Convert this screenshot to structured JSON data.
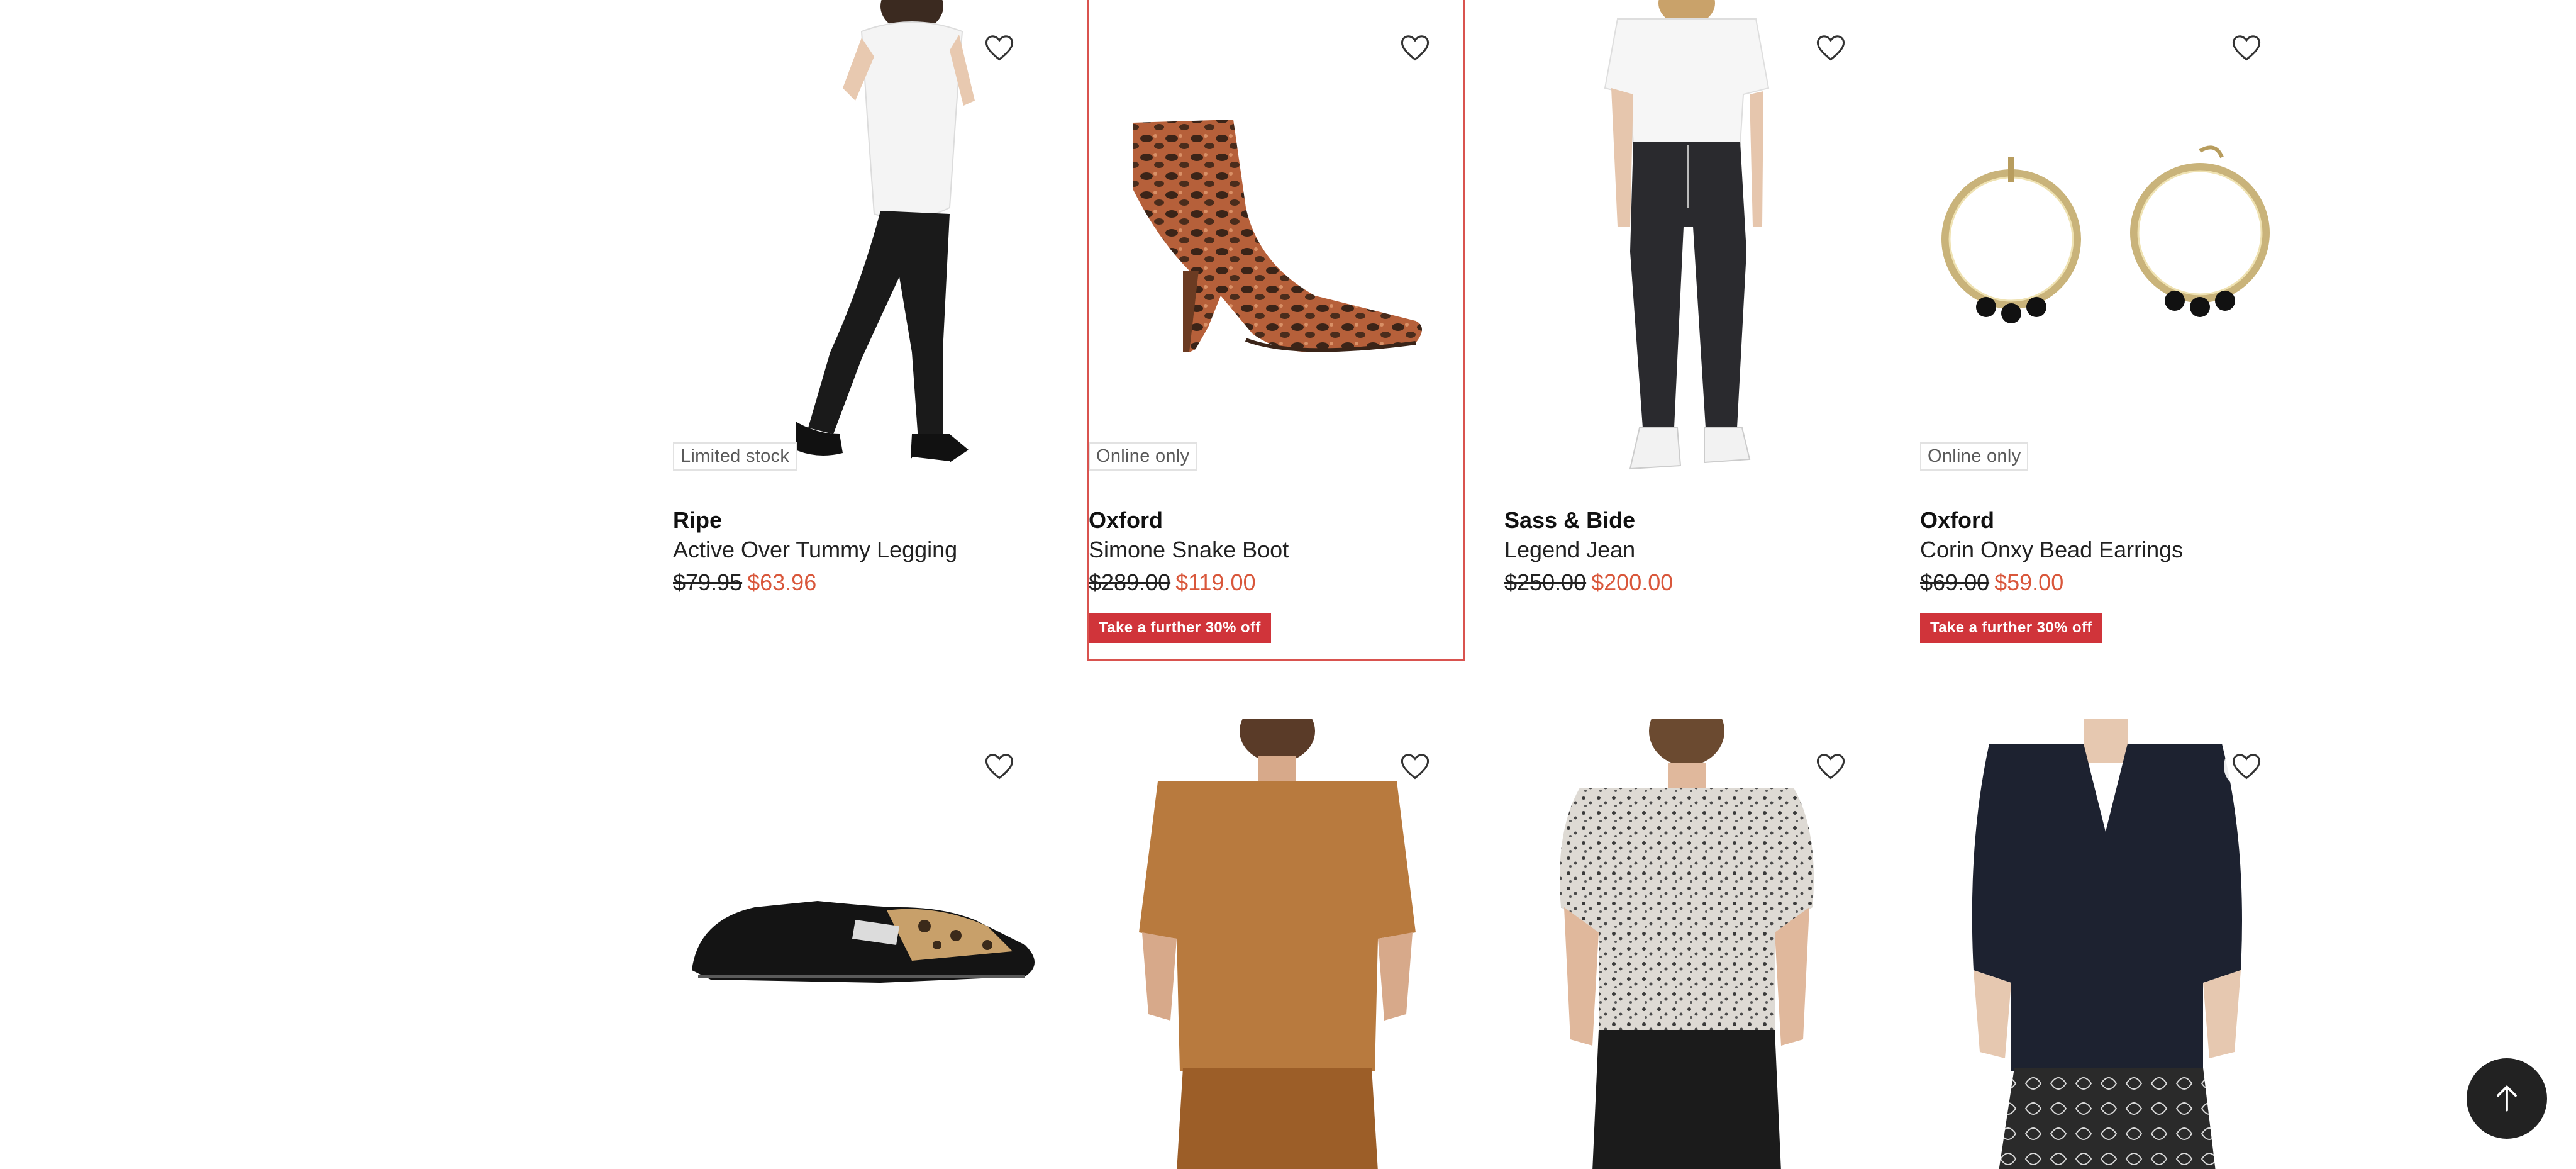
{
  "products": [
    {
      "brand": "Ripe",
      "name": "Active Over Tummy Legging",
      "was_price": "$79.95",
      "now_price": "$63.96",
      "badge": "Limited stock",
      "promo": ""
    },
    {
      "brand": "Oxford",
      "name": "Simone Snake Boot",
      "was_price": "$289.00",
      "now_price": "$119.00",
      "badge": "Online only",
      "promo": "Take a further 30% off"
    },
    {
      "brand": "Sass & Bide",
      "name": "Legend Jean",
      "was_price": "$250.00",
      "now_price": "$200.00",
      "badge": "",
      "promo": ""
    },
    {
      "brand": "Oxford",
      "name": "Corin Onxy Bead Earrings",
      "was_price": "$69.00",
      "now_price": "$59.00",
      "badge": "Online only",
      "promo": "Take a further 30% off"
    }
  ],
  "icons": {
    "favorite": "heart-outline-icon",
    "back_to_top": "arrow-up-icon"
  },
  "colors": {
    "sale_price": "#d9573b",
    "promo_bg": "#d0343a",
    "hover_outline": "#d9534f",
    "back_to_top_bg": "#222222"
  }
}
